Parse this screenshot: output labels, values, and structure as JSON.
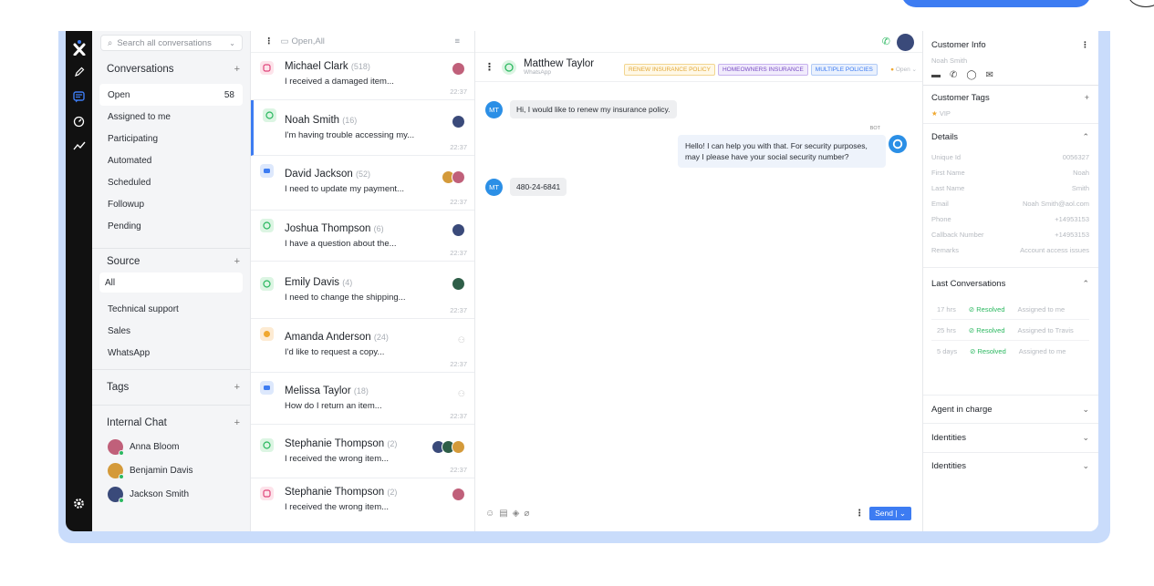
{
  "search": {
    "placeholder": "Search all conversations"
  },
  "sidebar": {
    "conversations_label": "Conversations",
    "items": [
      {
        "label": "Open",
        "count": "58"
      },
      {
        "label": "Assigned to me"
      },
      {
        "label": "Participating"
      },
      {
        "label": "Automated"
      },
      {
        "label": "Scheduled"
      },
      {
        "label": "Followup"
      },
      {
        "label": "Pending"
      }
    ],
    "source_label": "Source",
    "sources": [
      {
        "label": "All"
      },
      {
        "label": "Technical support"
      },
      {
        "label": "Sales"
      },
      {
        "label": "WhatsApp"
      }
    ],
    "tags_label": "Tags",
    "internal_chat_label": "Internal Chat",
    "agents": [
      {
        "name": "Anna Bloom",
        "color": "#c0607a"
      },
      {
        "name": "Benjamin Davis",
        "color": "#d49a3a"
      },
      {
        "name": "Jackson Smith",
        "color": "#3a4a7a"
      }
    ]
  },
  "list": {
    "filter_label": "Open,All",
    "conversations": [
      {
        "name": "Michael Clark",
        "count": "(518)",
        "preview": "I received a damaged item...",
        "time": "22:37",
        "channel": "instagram"
      },
      {
        "name": "Noah Smith",
        "count": "(16)",
        "preview": "I'm having trouble accessing my...",
        "time": "22:37",
        "channel": "whatsapp"
      },
      {
        "name": "David Jackson",
        "count": "(52)",
        "preview": "I need to update my payment...",
        "time": "22:37",
        "channel": "chat"
      },
      {
        "name": "Joshua Thompson",
        "count": "(6)",
        "preview": "I have a question about the...",
        "time": "22:37",
        "channel": "whatsapp"
      },
      {
        "name": "Emily Davis",
        "count": "(4)",
        "preview": "I need to change the shipping...",
        "time": "22:37",
        "channel": "whatsapp"
      },
      {
        "name": "Amanda Anderson",
        "count": "(24)",
        "preview": "I'd like to request a copy...",
        "time": "22:37",
        "channel": "chatbot"
      },
      {
        "name": "Melissa Taylor",
        "count": "(18)",
        "preview": "How do I return an item...",
        "time": "22:37",
        "channel": "chat"
      },
      {
        "name": "Stephanie Thompson",
        "count": "(2)",
        "preview": "I received the wrong item...",
        "time": "22:37",
        "channel": "whatsapp"
      },
      {
        "name": "Stephanie Thompson",
        "count": "(2)",
        "preview": "I received the wrong item...",
        "time": "22:37",
        "channel": "instagram"
      }
    ]
  },
  "chat": {
    "contact_name": "Matthew Taylor",
    "contact_channel": "WhatsApp",
    "tags": [
      "RENEW INSURANCE POLICY",
      "HOMEOWNERS INSURANCE",
      "MULTIPLE POLICIES"
    ],
    "status": "Open",
    "messages": [
      {
        "from": "MT",
        "text": "Hi, I would like to renew my insurance policy."
      },
      {
        "from": "BOT",
        "text": "Hello! I can help you with that. For security purposes, may I please have your social security number?"
      },
      {
        "from": "MT",
        "text": "480-24-6841"
      }
    ],
    "send_label": "Send"
  },
  "info": {
    "title": "Customer Info",
    "customer_name": "Noah Smith",
    "tags_title": "Customer Tags",
    "tag_vip": "VIP",
    "details_title": "Details",
    "details": [
      {
        "k": "Unique Id",
        "v": "0056327"
      },
      {
        "k": "First Name",
        "v": "Noah"
      },
      {
        "k": "Last Name",
        "v": "Smith"
      },
      {
        "k": "Email",
        "v": "Noah Smith@aol.com"
      },
      {
        "k": "Phone",
        "v": "+14953153"
      },
      {
        "k": "Callback Number",
        "v": "+14953153"
      },
      {
        "k": "Remarks",
        "v": "Account access issues"
      }
    ],
    "last_conv_title": "Last Conversations",
    "last_convs": [
      {
        "ago": "17 hrs",
        "status": "Resolved",
        "assigned": "Assigned to me"
      },
      {
        "ago": "25 hrs",
        "status": "Resolved",
        "assigned": "Assigned to Travis"
      },
      {
        "ago": "5 days",
        "status": "Resolved",
        "assigned": "Assigned to me"
      }
    ],
    "agent_in_charge": "Agent in charge",
    "identities_1": "Identities",
    "identities_2": "Identities"
  }
}
